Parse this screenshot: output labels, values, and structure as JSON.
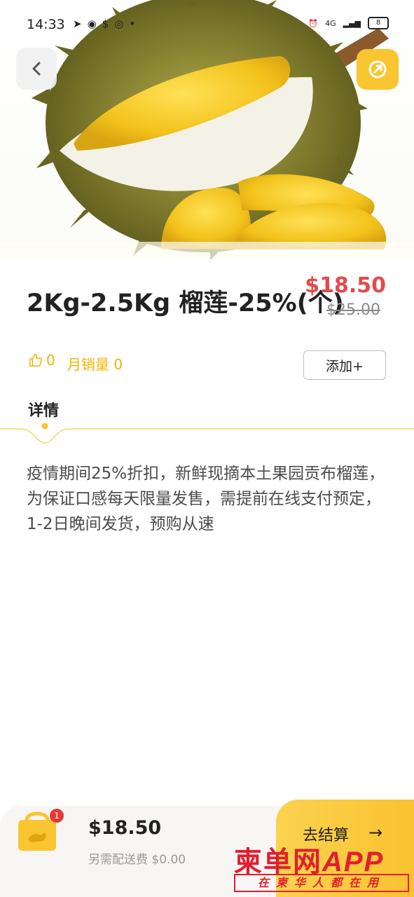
{
  "status_bar": {
    "time": "14:33",
    "app_icons": [
      "telegram-icon",
      "messenger-icon",
      "dollar-icon",
      "app-icon",
      "dot"
    ],
    "network": "4G",
    "battery": "8"
  },
  "product": {
    "title": "2Kg-2.5Kg 榴莲-25%(个)",
    "price": "$18.50",
    "original_price": "$25.00",
    "likes": "0",
    "monthly_sales": "月销量 0",
    "add_label": "添加+"
  },
  "tabs": {
    "detail": "详情"
  },
  "description": "疫情期间25%折扣，新鲜现摘本土果园贡布榴莲，为保证口感每天限量发售，需提前在线支付预定，1-2日晚间发货，预购从速",
  "cart": {
    "badge": "1",
    "total": "$18.50",
    "delivery": "另需配送费 $0.00",
    "checkout": "去结算"
  },
  "watermark": {
    "main": "柬单网",
    "app": "APP",
    "sub": "在柬华人都在用"
  },
  "colors": {
    "accent": "#f9c530",
    "price": "#e24b4b",
    "watermark": "#e11f2e"
  }
}
